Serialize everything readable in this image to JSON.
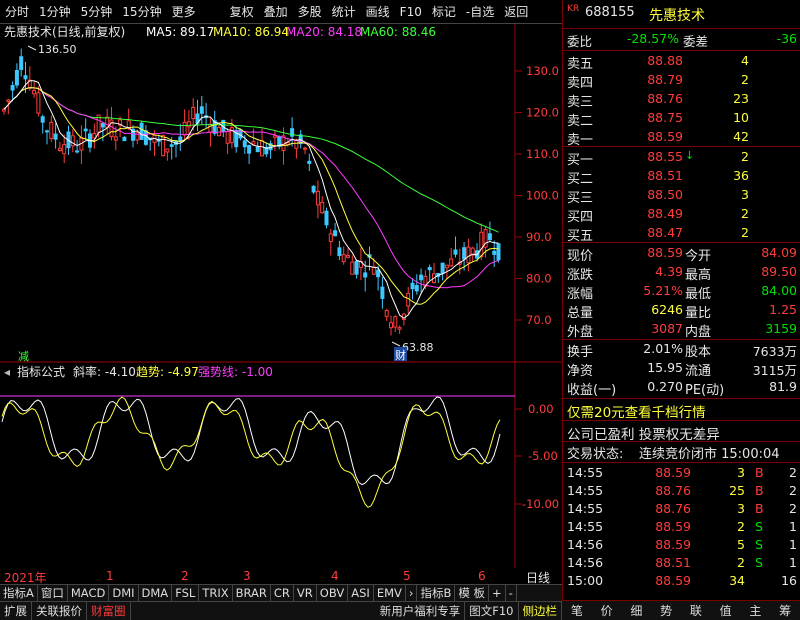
{
  "toolbar": {
    "periods": [
      "分时",
      "1分钟",
      "5分钟",
      "15分钟",
      "更多"
    ],
    "actions": [
      "复权",
      "叠加",
      "多股",
      "统计",
      "画线",
      "F10",
      "标记",
      "-自选",
      "返回"
    ]
  },
  "chart_header": {
    "title": "先惠技术(日线,前复权)",
    "ma5": "MA5: 89.17",
    "ma10": "MA10: 86.94",
    "ma20": "MA20: 84.18",
    "ma60": "MA60: 88.46",
    "high_mark": "136.50",
    "low_mark": "63.88",
    "jian_mark": "减",
    "cai_mark": "财"
  },
  "indicator_header": {
    "name": "指标公式",
    "slope": "斜率: -4.10",
    "trend": "趋势: -4.97",
    "strong": "强势线: -1.00"
  },
  "time_axis": {
    "year": "2021年",
    "months": [
      "2",
      "3",
      "4",
      "5",
      "6"
    ],
    "month_1": "1",
    "right_label": "日线"
  },
  "indicator_tabs": [
    "指标A",
    "窗口",
    "MACD",
    "DMI",
    "DMA",
    "FSL",
    "TRIX",
    "BRAR",
    "CR",
    "VR",
    "OBV",
    "ASI",
    "EMV",
    "指标B",
    "模 板",
    "+",
    "-"
  ],
  "bottom_tabs": [
    "扩展",
    "关联报价",
    "财富圈",
    "新用户福利专享",
    "图文F10",
    "侧边栏"
  ],
  "panel": {
    "market_tag": "KR",
    "code": "688155",
    "name": "先惠技术",
    "webi_label": "委比",
    "webi_value": "-28.57%",
    "weicha_label": "委差",
    "weicha_value": "-36",
    "asks": [
      {
        "label": "卖五",
        "price": "88.88",
        "vol": "4"
      },
      {
        "label": "卖四",
        "price": "88.79",
        "vol": "2"
      },
      {
        "label": "卖三",
        "price": "88.76",
        "vol": "23"
      },
      {
        "label": "卖二",
        "price": "88.75",
        "vol": "10"
      },
      {
        "label": "卖一",
        "price": "88.59",
        "vol": "42"
      }
    ],
    "bids": [
      {
        "label": "买一",
        "price": "88.55",
        "vol": "2"
      },
      {
        "label": "买二",
        "price": "88.51",
        "vol": "36"
      },
      {
        "label": "买三",
        "price": "88.50",
        "vol": "3"
      },
      {
        "label": "买四",
        "price": "88.49",
        "vol": "2"
      },
      {
        "label": "买五",
        "price": "88.47",
        "vol": "2"
      }
    ],
    "stats": [
      {
        "l1": "现价",
        "v1": "88.59",
        "l2": "今开",
        "v2": "84.09"
      },
      {
        "l1": "涨跌",
        "v1": "4.39",
        "l2": "最高",
        "v2": "89.50"
      },
      {
        "l1": "涨幅",
        "v1": "5.21%",
        "l2": "最低",
        "v2": "84.00"
      },
      {
        "l1": "总量",
        "v1": "6246",
        "l2": "量比",
        "v2": "1.25"
      },
      {
        "l1": "外盘",
        "v1": "3087",
        "l2": "内盘",
        "v2": "3159"
      }
    ],
    "stats2": [
      {
        "l1": "换手",
        "v1": "2.01%",
        "l2": "股本",
        "v2": "7633万"
      },
      {
        "l1": "净资",
        "v1": "15.95",
        "l2": "流通",
        "v2": "3115万"
      },
      {
        "l1": "收益(一)",
        "v1": "0.270",
        "l2": "PE(动)",
        "v2": "81.9"
      }
    ],
    "promo": "仅需20元查看千档行情",
    "notice": "公司已盈利 投票权无差异",
    "trade_status_label": "交易状态:",
    "trade_status": "连续竞价闭市 15:00:04",
    "ticks": [
      {
        "time": "14:55",
        "price": "88.59",
        "vol": "3",
        "side": "B",
        "n": "2"
      },
      {
        "time": "14:55",
        "price": "88.76",
        "vol": "25",
        "side": "B",
        "n": "2"
      },
      {
        "time": "14:55",
        "price": "88.76",
        "vol": "3",
        "side": "B",
        "n": "2"
      },
      {
        "time": "14:55",
        "price": "88.59",
        "vol": "2",
        "side": "S",
        "n": "1"
      },
      {
        "time": "14:56",
        "price": "88.59",
        "vol": "5",
        "side": "S",
        "n": "1"
      },
      {
        "time": "14:56",
        "price": "88.51",
        "vol": "2",
        "side": "S",
        "n": "1"
      },
      {
        "time": "15:00",
        "price": "88.59",
        "vol": "34",
        "side": "",
        "n": "16"
      }
    ],
    "bottom": [
      "笔",
      "价",
      "细",
      "势",
      "联",
      "值",
      "主",
      "筹"
    ]
  },
  "colors": {
    "up": "#ff3c3c",
    "down": "#00e000",
    "ma5": "#ffffff",
    "ma10": "#ffff3c",
    "ma20": "#ff3cff",
    "ma60": "#3cff3c",
    "axis": "#a00000"
  }
}
